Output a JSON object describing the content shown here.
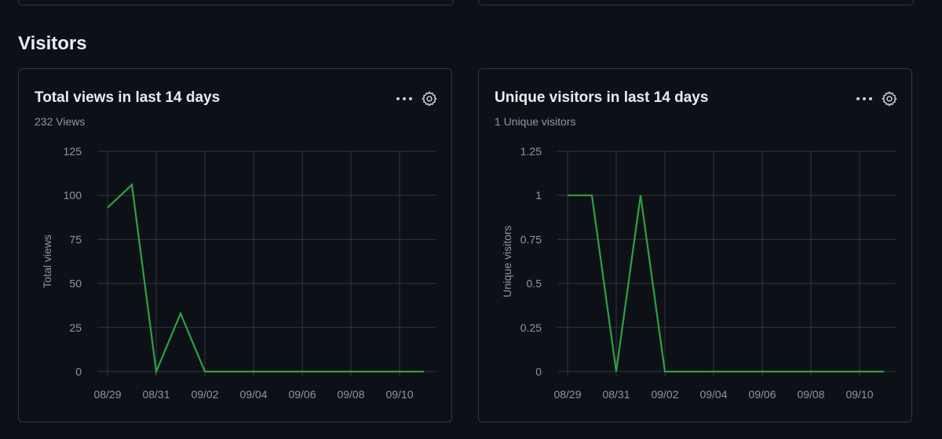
{
  "section": {
    "title": "Visitors"
  },
  "colors": {
    "background": "#0d1117",
    "border": "#30363d",
    "grid": "#30363d",
    "line": "#2ea043",
    "text_muted": "#8d96a0"
  },
  "cards": [
    {
      "title": "Total views in last 14 days",
      "subtitle": "232 Views",
      "icons": {
        "more": "kebab-horizontal-icon",
        "settings": "gear-icon"
      }
    },
    {
      "title": "Unique visitors in last 14 days",
      "subtitle": "1 Unique visitors",
      "icons": {
        "more": "kebab-horizontal-icon",
        "settings": "gear-icon"
      }
    }
  ],
  "chart_data": [
    {
      "type": "line",
      "title": "",
      "xlabel": "",
      "ylabel": "Total views",
      "x": [
        "08/29",
        "08/30",
        "08/31",
        "09/01",
        "09/02",
        "09/03",
        "09/04",
        "09/05",
        "09/06",
        "09/07",
        "09/08",
        "09/09",
        "09/10",
        "09/11"
      ],
      "values": [
        93,
        106,
        0,
        33,
        0,
        0,
        0,
        0,
        0,
        0,
        0,
        0,
        0,
        0
      ],
      "xticks": [
        "08/29",
        "08/31",
        "09/02",
        "09/04",
        "09/06",
        "09/08",
        "09/10"
      ],
      "yticks": [
        "0",
        "25",
        "50",
        "75",
        "100",
        "125"
      ],
      "ylim": [
        0,
        125
      ],
      "grid": true
    },
    {
      "type": "line",
      "title": "",
      "xlabel": "",
      "ylabel": "Unique visitors",
      "x": [
        "08/29",
        "08/30",
        "08/31",
        "09/01",
        "09/02",
        "09/03",
        "09/04",
        "09/05",
        "09/06",
        "09/07",
        "09/08",
        "09/09",
        "09/10",
        "09/11"
      ],
      "values": [
        1,
        1,
        0,
        1,
        0,
        0,
        0,
        0,
        0,
        0,
        0,
        0,
        0,
        0
      ],
      "xticks": [
        "08/29",
        "08/31",
        "09/02",
        "09/04",
        "09/06",
        "09/08",
        "09/10"
      ],
      "yticks": [
        "0",
        "0.25",
        "0.5",
        "0.75",
        "1",
        "1.25"
      ],
      "ylim": [
        0,
        1.25
      ],
      "grid": true
    }
  ]
}
